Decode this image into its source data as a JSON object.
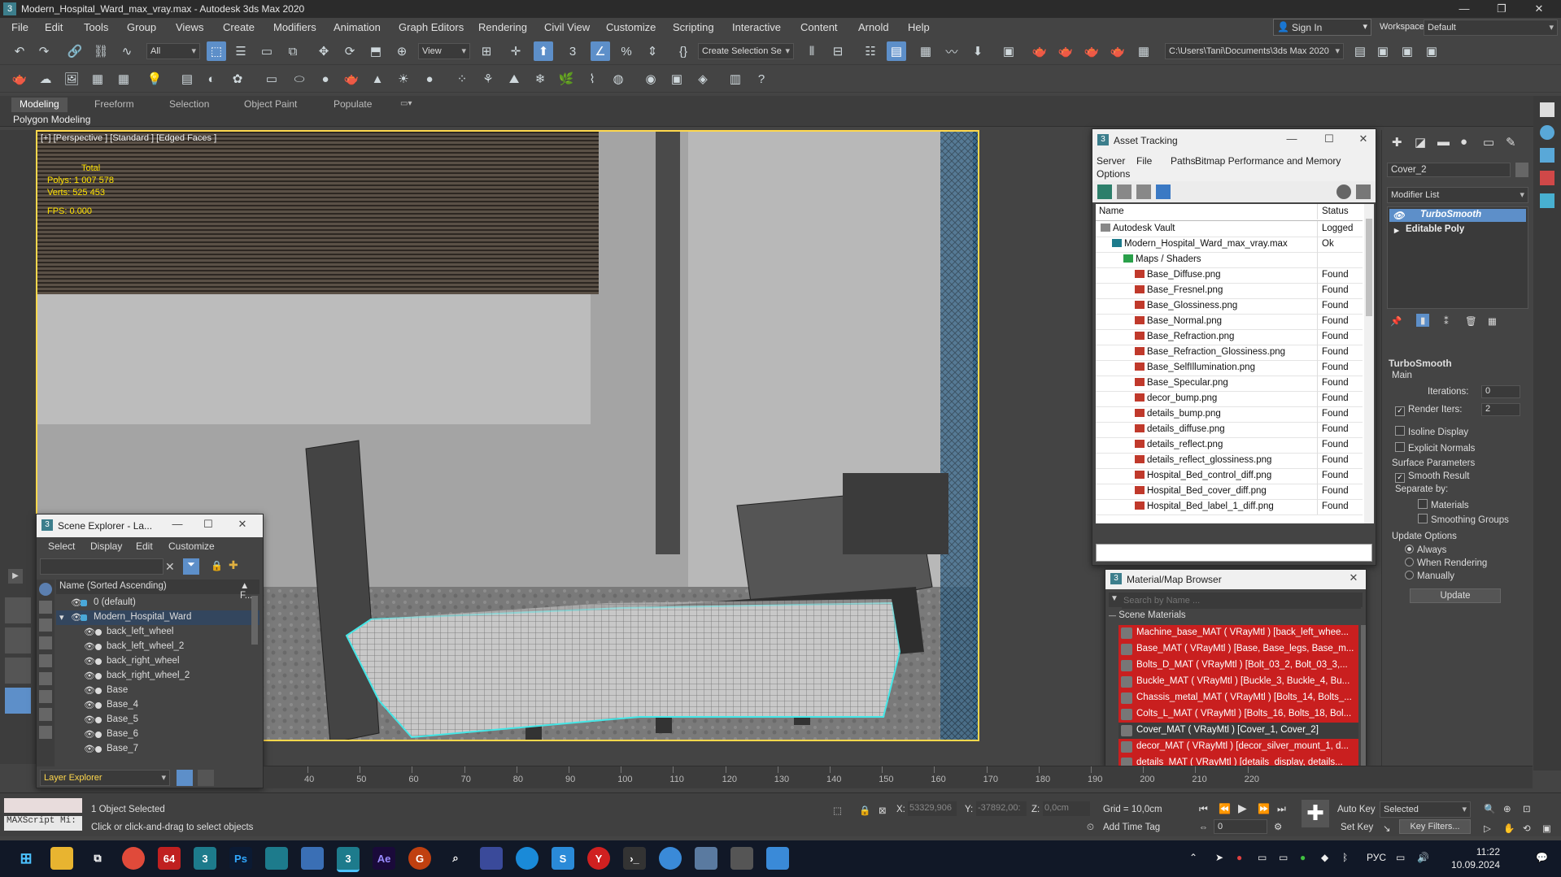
{
  "window": {
    "title": "Modern_Hospital_Ward_max_vray.max - Autodesk 3ds Max 2020",
    "app_icon": "3"
  },
  "menu": [
    "File",
    "Edit",
    "Tools",
    "Group",
    "Views",
    "Create",
    "Modifiers",
    "Animation",
    "Graph Editors",
    "Rendering",
    "Civil View",
    "Customize",
    "Scripting",
    "Interactive",
    "Content",
    "Arnold",
    "Help"
  ],
  "account": {
    "sign_in": "Sign In",
    "workspaces_label": "Workspaces:",
    "workspace": "Default"
  },
  "toolbar": {
    "selection_filter": "All",
    "ref_coord": "View",
    "named_selection": "Create Selection Se",
    "project_path": "C:\\Users\\Tani\\Documents\\3ds Max 2020"
  },
  "ribbon": {
    "tabs": [
      "Modeling",
      "Freeform",
      "Selection",
      "Object Paint",
      "Populate"
    ],
    "active_tab": "Modeling",
    "sub": "Polygon Modeling"
  },
  "viewport": {
    "label": "[+] [Perspective ] [Standard ] [Edged Faces ]",
    "stats": {
      "total_label": "Total",
      "polys_label": "Polys:",
      "polys": "1 007 578",
      "verts_label": "Verts:",
      "verts": "525 453",
      "fps_label": "FPS:",
      "fps": "0.000"
    }
  },
  "asset_tracking": {
    "title": "Asset Tracking",
    "menu": [
      "Server",
      "File",
      "Paths",
      "Bitmap Performance and Memory",
      "Options"
    ],
    "col_name": "Name",
    "col_status": "Status",
    "rows": [
      {
        "name": "Autodesk Vault",
        "status": "Logged",
        "indent": 0
      },
      {
        "name": "Modern_Hospital_Ward_max_vray.max",
        "status": "Ok",
        "indent": 1
      },
      {
        "name": "Maps / Shaders",
        "status": "",
        "indent": 2
      },
      {
        "name": "Base_Diffuse.png",
        "status": "Found",
        "indent": 3
      },
      {
        "name": "Base_Fresnel.png",
        "status": "Found",
        "indent": 3
      },
      {
        "name": "Base_Glossiness.png",
        "status": "Found",
        "indent": 3
      },
      {
        "name": "Base_Normal.png",
        "status": "Found",
        "indent": 3
      },
      {
        "name": "Base_Refraction.png",
        "status": "Found",
        "indent": 3
      },
      {
        "name": "Base_Refraction_Glossiness.png",
        "status": "Found",
        "indent": 3
      },
      {
        "name": "Base_SelfIllumination.png",
        "status": "Found",
        "indent": 3
      },
      {
        "name": "Base_Specular.png",
        "status": "Found",
        "indent": 3
      },
      {
        "name": "decor_bump.png",
        "status": "Found",
        "indent": 3
      },
      {
        "name": "details_bump.png",
        "status": "Found",
        "indent": 3
      },
      {
        "name": "details_diffuse.png",
        "status": "Found",
        "indent": 3
      },
      {
        "name": "details_reflect.png",
        "status": "Found",
        "indent": 3
      },
      {
        "name": "details_reflect_glossiness.png",
        "status": "Found",
        "indent": 3
      },
      {
        "name": "Hospital_Bed_control_diff.png",
        "status": "Found",
        "indent": 3
      },
      {
        "name": "Hospital_Bed_cover_diff.png",
        "status": "Found",
        "indent": 3
      },
      {
        "name": "Hospital_Bed_label_1_diff.png",
        "status": "Found",
        "indent": 3
      }
    ]
  },
  "material_browser": {
    "title": "Material/Map Browser",
    "search_placeholder": "Search by Name ...",
    "section": "Scene Materials",
    "items": [
      "Machine_base_MAT  ( VRayMtl )  [back_left_whee...",
      "Base_MAT  ( VRayMtl )  [Base, Base_legs, Base_m...",
      "Bolts_D_MAT  ( VRayMtl )  [Bolt_03_2, Bolt_03_3,...",
      "Buckle_MAT  ( VRayMtl )  [Buckle_3, Buckle_4, Bu...",
      "Chassis_metal_MAT  ( VRayMtl )  [Bolts_14, Bolts_...",
      "Colts_L_MAT  ( VRayMtl )  [Bolts_16, Bolts_18, Bol...",
      "Cover_MAT  ( VRayMtl )  [Cover_1, Cover_2]",
      "decor_MAT  ( VRayMtl )  [decor_silver_mount_1, d...",
      "details_MAT  ( VRayMtl )  [details_display, details..."
    ],
    "selected_index": 6
  },
  "scene_explorer": {
    "title": "Scene Explorer - La...",
    "menu": [
      "Select",
      "Display",
      "Edit",
      "Customize"
    ],
    "col_name": "Name (Sorted Ascending)",
    "col_f": "▲ F...",
    "rows": [
      {
        "name": "0 (default)",
        "indent": 1
      },
      {
        "name": "Modern_Hospital_Ward",
        "indent": 1,
        "selected": true
      },
      {
        "name": "back_left_wheel",
        "indent": 2
      },
      {
        "name": "back_left_wheel_2",
        "indent": 2
      },
      {
        "name": "back_right_wheel",
        "indent": 2
      },
      {
        "name": "back_right_wheel_2",
        "indent": 2
      },
      {
        "name": "Base",
        "indent": 2
      },
      {
        "name": "Base_4",
        "indent": 2
      },
      {
        "name": "Base_5",
        "indent": 2
      },
      {
        "name": "Base_6",
        "indent": 2
      },
      {
        "name": "Base_7",
        "indent": 2
      }
    ],
    "footer": "Layer Explorer"
  },
  "command_panel": {
    "object_name": "Cover_2",
    "modifier_list": "Modifier List",
    "stack": [
      {
        "name": "TurboSmooth",
        "active": true
      },
      {
        "name": "Editable Poly",
        "active": false
      }
    ],
    "rollout": "TurboSmooth",
    "main_label": "Main",
    "iterations_label": "Iterations:",
    "iterations": "0",
    "render_iters_label": "Render Iters:",
    "render_iters": "2",
    "isoline": "Isoline Display",
    "explicit_normals": "Explicit Normals",
    "surface_params": "Surface Parameters",
    "smooth_result": "Smooth Result",
    "separate_by": "Separate by:",
    "materials": "Materials",
    "smoothing_groups": "Smoothing Groups",
    "update_options": "Update Options",
    "always": "Always",
    "when_rendering": "When Rendering",
    "manually": "Manually",
    "update_btn": "Update"
  },
  "timeline": {
    "ticks": [
      "40",
      "50",
      "60",
      "70",
      "80",
      "90",
      "100",
      "110",
      "120",
      "130",
      "140",
      "150",
      "160",
      "170",
      "180",
      "190",
      "200",
      "210",
      "220"
    ]
  },
  "status": {
    "script_label": "MAXScript Mi:",
    "selected": "1 Object Selected",
    "prompt": "Click or click-and-drag to select objects",
    "x_label": "X:",
    "x": "53329,906",
    "y_label": "Y:",
    "y": "-37892,00:",
    "z_label": "Z:",
    "z": "0,0cm",
    "grid": "Grid = 10,0cm",
    "add_time_tag": "Add Time Tag",
    "auto_key": "Auto Key",
    "key_mode": "Selected",
    "set_key": "Set Key",
    "key_filters": "Key Filters...",
    "frame": "0"
  },
  "taskbar": {
    "lang": "РУС",
    "time": "11:22",
    "date": "10.09.2024"
  }
}
